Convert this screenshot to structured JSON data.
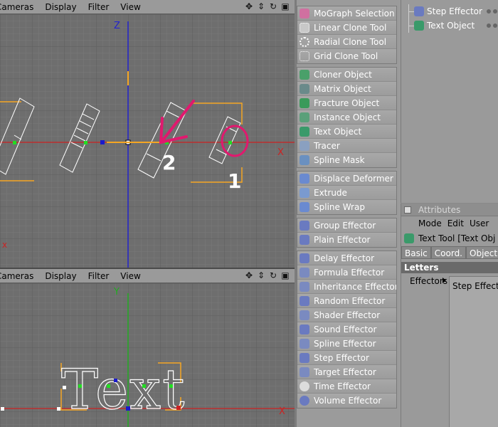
{
  "viewport_menu": [
    "Cameras",
    "Display",
    "Filter",
    "View"
  ],
  "top_viewport": {
    "axis_z": "Z",
    "axis_x": "X",
    "annotation_1": "1",
    "annotation_2": "2"
  },
  "bottom_viewport": {
    "axis_y": "Y",
    "axis_x": "X",
    "text_geometry": "Text"
  },
  "tool_groups": [
    [
      "MoGraph Selection",
      "Linear Clone Tool",
      "Radial Clone Tool",
      "Grid Clone Tool"
    ],
    [
      "Cloner Object",
      "Matrix Object",
      "Fracture Object",
      "Instance Object",
      "Text Object",
      "Tracer",
      "Spline Mask"
    ],
    [
      "Displace Deformer",
      "Extrude",
      "Spline Wrap"
    ],
    [
      "Group Effector",
      "Plain Effector"
    ],
    [
      "Delay Effector",
      "Formula Effector",
      "Inheritance Effector",
      "Random Effector",
      "Shader Effector",
      "Sound Effector",
      "Spline Effector",
      "Step Effector",
      "Target Effector",
      "Time Effector",
      "Volume Effector"
    ]
  ],
  "objects": {
    "step_effector": "Step Effector",
    "text_object": "Text Object"
  },
  "attributes": {
    "header": "Attributes",
    "menu": [
      "Mode",
      "Edit",
      "User"
    ],
    "title": "Text Tool [Text Obj",
    "tabs": [
      "Basic",
      "Coord.",
      "Object"
    ],
    "section": "Letters",
    "effectors_label": "Effectors",
    "effectors_item": "Step Effecto"
  },
  "colors": {
    "annotation": "#e0196e",
    "selection": "#f5a623",
    "axis_z": "#2222cc",
    "axis_x": "#cc2222",
    "axis_y": "#22aa22"
  }
}
